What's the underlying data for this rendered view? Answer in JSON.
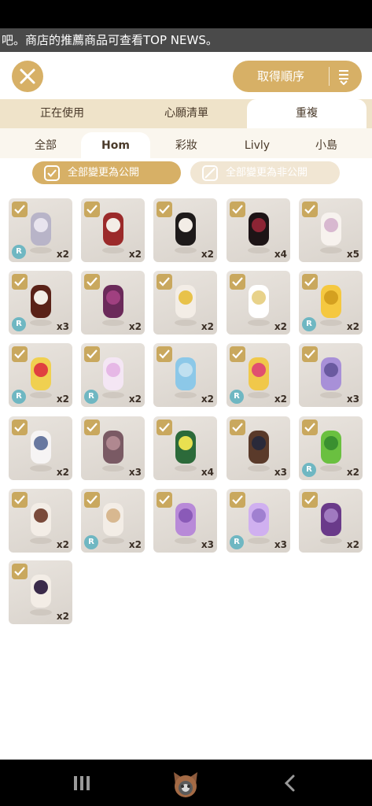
{
  "news_ticker": "吧。商店的推薦商品可查看TOP NEWS。",
  "header": {
    "close_icon": "close-icon",
    "sort_label": "取得順序",
    "sort_icon": "sort-icon"
  },
  "tabs_primary": [
    {
      "label": "正在使用",
      "active": false
    },
    {
      "label": "心願清單",
      "active": false
    },
    {
      "label": "重複",
      "active": true
    }
  ],
  "tabs_secondary": [
    {
      "label": "全部",
      "active": false
    },
    {
      "label": "Hom",
      "active": true
    },
    {
      "label": "彩妝",
      "active": false
    },
    {
      "label": "Livly",
      "active": false
    },
    {
      "label": "小島",
      "active": false
    }
  ],
  "filters": {
    "public_label": "全部變更為公開",
    "private_label": "全部變更為非公開"
  },
  "rare_label": "R",
  "items": [
    {
      "name": "silver-wavy-hair",
      "qty": "x2",
      "rare": true
    },
    {
      "name": "red-vest-outfit",
      "qty": "x2",
      "rare": false
    },
    {
      "name": "black-beret-hair",
      "qty": "x2",
      "rare": false
    },
    {
      "name": "black-fedora-hat",
      "qty": "x4",
      "rare": false
    },
    {
      "name": "flower-hairpin",
      "qty": "x5",
      "rare": false
    },
    {
      "name": "devil-horns",
      "qty": "x3",
      "rare": true
    },
    {
      "name": "purple-skirt",
      "qty": "x2",
      "rare": false
    },
    {
      "name": "flower-socks",
      "qty": "x2",
      "rare": false
    },
    {
      "name": "white-flower-cape",
      "qty": "x2",
      "rare": false
    },
    {
      "name": "yellow-dress",
      "qty": "x2",
      "rare": true
    },
    {
      "name": "yellow-outfit",
      "qty": "x2",
      "rare": true
    },
    {
      "name": "pink-tutu-dress",
      "qty": "x2",
      "rare": true
    },
    {
      "name": "blue-ribbon-top",
      "qty": "x2",
      "rare": false
    },
    {
      "name": "flower-wand",
      "qty": "x2",
      "rare": true
    },
    {
      "name": "crystal-staff",
      "qty": "x3",
      "rare": false
    },
    {
      "name": "cat-mask",
      "qty": "x2",
      "rare": false
    },
    {
      "name": "scroll-prop",
      "qty": "x3",
      "rare": false
    },
    {
      "name": "green-leaf",
      "qty": "x4",
      "rare": false
    },
    {
      "name": "brown-coat-outfit",
      "qty": "x3",
      "rare": false
    },
    {
      "name": "green-frog-plush",
      "qty": "x2",
      "rare": true
    },
    {
      "name": "brown-boots",
      "qty": "x2",
      "rare": false
    },
    {
      "name": "hair-bun",
      "qty": "x2",
      "rare": true
    },
    {
      "name": "purple-kimono-top",
      "qty": "x3",
      "rare": false
    },
    {
      "name": "lavender-dress",
      "qty": "x3",
      "rare": true
    },
    {
      "name": "purple-robe",
      "qty": "x2",
      "rare": false
    },
    {
      "name": "purple-shoes-socks",
      "qty": "x2",
      "rare": false
    }
  ],
  "nav": {
    "recent_icon": "recent-apps-icon",
    "home_icon": "home-cat-icon",
    "back_icon": "back-icon"
  },
  "colors": {
    "accent": "#d7b066",
    "tab_bg": "#efe3c9",
    "rare_badge": "#6fb7c2"
  }
}
